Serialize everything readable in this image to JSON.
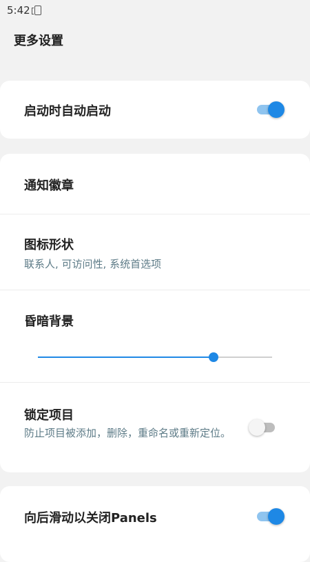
{
  "status_bar": {
    "time": "5:42"
  },
  "page": {
    "title": "更多设置"
  },
  "settings": {
    "auto_start": {
      "label": "启动时自动启动",
      "enabled": true
    },
    "notification_badge": {
      "label": "通知徽章"
    },
    "icon_shape": {
      "label": "图标形状",
      "summary": "联系人, 可访问性, 系统首选项"
    },
    "dim_background": {
      "label": "昏暗背景",
      "level": 0.75
    },
    "lock_items": {
      "label": "锁定项目",
      "summary": "防止项目被添加，删除，重命名或重新定位。",
      "enabled": false
    },
    "swipe_back_close": {
      "label": "向后滑动以关闭Panels",
      "enabled": true
    }
  },
  "colors": {
    "accent": "#1e88e5",
    "accent_track": "#8fc4ef",
    "summary_text": "#5d7b87",
    "background": "#f2f2f2"
  }
}
